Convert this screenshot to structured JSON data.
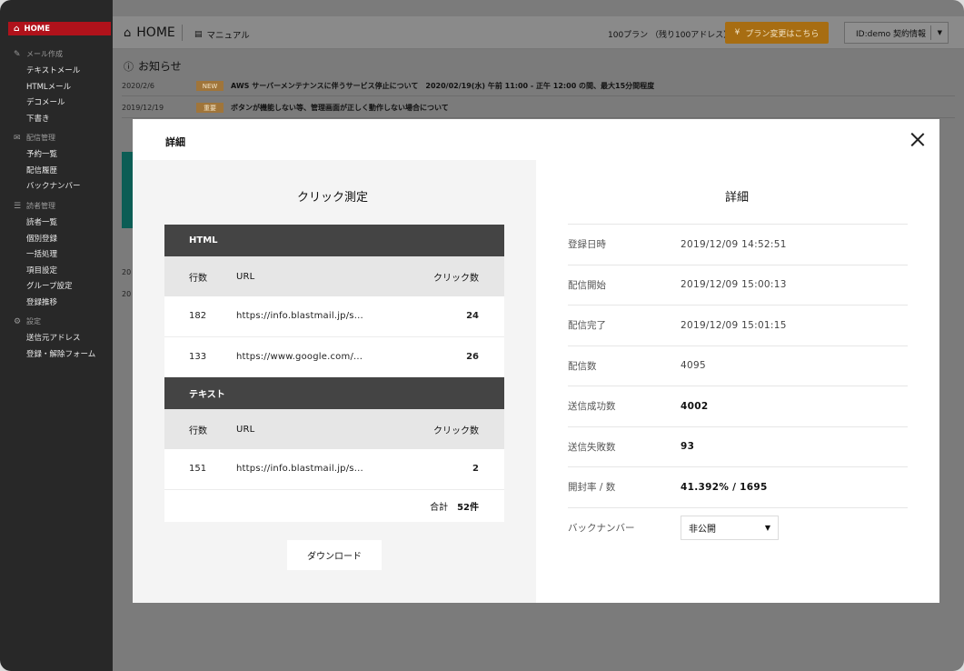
{
  "sidebar": {
    "home": "HOME",
    "sections": [
      {
        "label": "メール作成",
        "icon": "pencil-icon",
        "items": [
          "テキストメール",
          "HTMLメール",
          "デコメール",
          "下書き"
        ]
      },
      {
        "label": "配信管理",
        "icon": "envelope-icon",
        "items": [
          "予約一覧",
          "配信履歴",
          "バックナンバー"
        ]
      },
      {
        "label": "読者管理",
        "icon": "list-icon",
        "items": [
          "読者一覧",
          "個別登録",
          "一括処理",
          "項目設定",
          "グループ設定",
          "登録推移"
        ]
      },
      {
        "label": "設定",
        "icon": "gear-icon",
        "items": [
          "送信元アドレス",
          "登録・解除フォーム"
        ]
      }
    ]
  },
  "topbar": {
    "home": "HOME",
    "manual": "マニュアル",
    "plan": "100プラン （残り100アドレス）",
    "change_plan": "プラン変更はこちら",
    "account": "ID:demo 契約情報"
  },
  "news": {
    "title": "お知らせ",
    "rows": [
      {
        "date": "2020/2/6",
        "badge": "NEW",
        "text": "AWS サーバーメンテナンスに伴うサービス停止について　2020/02/19(水) 午前 11:00 - 正午 12:00 の間、最大15分間程度"
      },
      {
        "date": "2019/12/19",
        "badge": "重要",
        "text": "ボタンが機能しない等、管理画面が正しく動作しない場合について"
      }
    ],
    "bg_fragments": [
      "20",
      "20"
    ]
  },
  "modal": {
    "title": "詳細",
    "click": {
      "heading": "クリック測定",
      "tables": [
        {
          "name": "HTML",
          "columns": [
            "行数",
            "URL",
            "クリック数"
          ],
          "rows": [
            {
              "line": "182",
              "url": "https://info.blastmail.jp/s...",
              "clicks": "24"
            },
            {
              "line": "133",
              "url": "https://www.google.com/...",
              "clicks": "26"
            }
          ]
        },
        {
          "name": "テキスト",
          "columns": [
            "行数",
            "URL",
            "クリック数"
          ],
          "rows": [
            {
              "line": "151",
              "url": "https://info.blastmail.jp/s...",
              "clicks": "2"
            }
          ]
        }
      ],
      "total_label": "合計",
      "total_value": "52件",
      "download": "ダウンロード"
    },
    "detail": {
      "heading": "詳細",
      "rows": [
        {
          "label": "登録日時",
          "value": "2019/12/09 14:52:51",
          "strong": false
        },
        {
          "label": "配信開始",
          "value": "2019/12/09 15:00:13",
          "strong": false
        },
        {
          "label": "配信完了",
          "value": "2019/12/09 15:01:15",
          "strong": false
        },
        {
          "label": "配信数",
          "value": "4095",
          "strong": false
        },
        {
          "label": "送信成功数",
          "value": "4002",
          "strong": true
        },
        {
          "label": "送信失敗数",
          "value": "93",
          "strong": true
        },
        {
          "label": "開封率 / 数",
          "value": "41.392% / 1695",
          "strong": true
        }
      ],
      "backnumber_label": "バックナンバー",
      "backnumber_value": "非公開"
    }
  }
}
